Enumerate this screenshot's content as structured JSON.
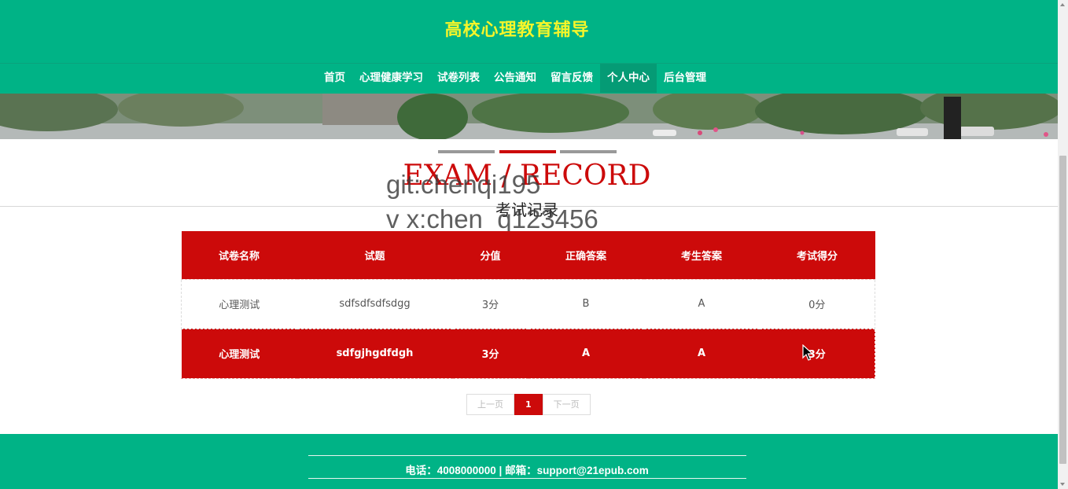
{
  "site": {
    "title": "高校心理教育辅导"
  },
  "nav": {
    "items": [
      {
        "label": "首页"
      },
      {
        "label": "心理健康学习"
      },
      {
        "label": "试卷列表"
      },
      {
        "label": "公告通知"
      },
      {
        "label": "留言反馈"
      },
      {
        "label": "个人中心",
        "active": true
      },
      {
        "label": "后台管理"
      }
    ]
  },
  "section": {
    "title_en": "EXAM / RECORD",
    "title_cn": "考试记录"
  },
  "watermark": {
    "line1": "git:chenqi195",
    "line2": "v x:chen_q123456"
  },
  "table": {
    "headers": [
      "试卷名称",
      "试题",
      "分值",
      "正确答案",
      "考生答案",
      "考试得分"
    ],
    "rows": [
      [
        "心理测试",
        "sdfsdfsdfsdgg",
        "3分",
        "B",
        "A",
        "0分"
      ],
      [
        "心理测试",
        "sdfgjhgdfdgh",
        "3分",
        "A",
        "A",
        "3分"
      ]
    ]
  },
  "pagination": {
    "prev": "上一页",
    "current": "1",
    "next": "下一页"
  },
  "footer": {
    "contact": "电话：4008000000 | 邮箱：support@21epub.com"
  },
  "colors": {
    "brand_green": "#00b386",
    "accent_red": "#cc0a0a",
    "title_yellow": "#f5f52a"
  }
}
